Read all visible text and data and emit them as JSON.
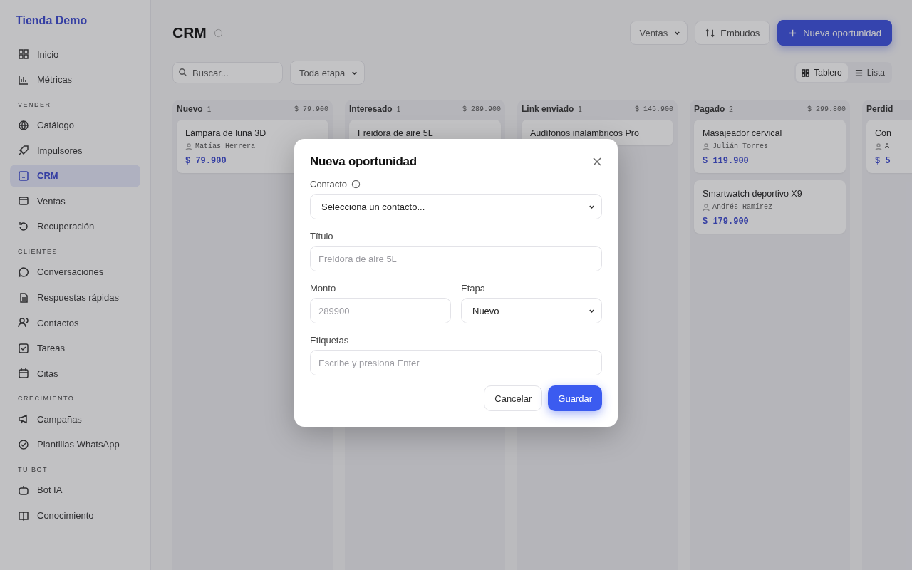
{
  "sidebar": {
    "brand": "Tienda Demo",
    "sections": [
      {
        "items": [
          {
            "label": "Inicio",
            "selected": false
          },
          {
            "label": "Métricas",
            "selected": false
          }
        ]
      },
      {
        "heading": "VENDER",
        "items": [
          {
            "label": "Catálogo",
            "selected": false
          },
          {
            "label": "Impulsores",
            "selected": false
          },
          {
            "label": "CRM",
            "selected": true
          },
          {
            "label": "Ventas",
            "selected": false
          },
          {
            "label": "Recuperación",
            "selected": false
          }
        ]
      },
      {
        "heading": "CLIENTES",
        "items": [
          {
            "label": "Conversaciones",
            "selected": false
          },
          {
            "label": "Respuestas rápidas",
            "selected": false
          },
          {
            "label": "Contactos",
            "selected": false
          },
          {
            "label": "Tareas",
            "selected": false
          },
          {
            "label": "Citas",
            "selected": false
          }
        ]
      },
      {
        "heading": "CRECIMIENTO",
        "items": [
          {
            "label": "Campañas",
            "selected": false
          },
          {
            "label": "Plantillas WhatsApp",
            "selected": false
          }
        ]
      },
      {
        "heading": "TU BOT",
        "items": [
          {
            "label": "Bot IA",
            "selected": false
          },
          {
            "label": "Conocimiento",
            "selected": false
          }
        ]
      }
    ]
  },
  "header": {
    "title": "CRM",
    "pipeline_select": "Ventas",
    "funnels_button": "Embudos",
    "new_button": "Nueva oportunidad"
  },
  "toolbar": {
    "search": {
      "placeholder": "Buscar..."
    },
    "stage_select": "Toda etapa",
    "views": [
      {
        "label": "Tablero",
        "selected": true
      },
      {
        "label": "Lista",
        "selected": false
      }
    ]
  },
  "board": {
    "columns": [
      {
        "name": "Nuevo",
        "count": "1",
        "total": "$ 79.900",
        "cards": [
          {
            "title": "Lámpara de luna 3D",
            "contact": "Matías Herrera",
            "amount": "$ 79.900"
          }
        ]
      },
      {
        "name": "Interesado",
        "count": "1",
        "total": "$ 289.900",
        "cards": [
          {
            "title": "Freidora de aire 5L"
          }
        ]
      },
      {
        "name": "Link enviado",
        "count": "1",
        "total": "$ 145.900",
        "cards": [
          {
            "title": "Audífonos inalámbricos Pro"
          }
        ]
      },
      {
        "name": "Pagado",
        "count": "2",
        "total": "$ 299.800",
        "cards": [
          {
            "title": "Masajeador cervical",
            "contact": "Julián Torres",
            "amount": "$ 119.900"
          },
          {
            "title": "Smartwatch deportivo X9",
            "contact": "Andrés Ramírez",
            "amount": "$ 179.900"
          }
        ]
      },
      {
        "name": "Perdid",
        "cards": [
          {
            "title": "Con",
            "contact": "A",
            "amount": "$ 5"
          }
        ]
      }
    ]
  },
  "modal": {
    "title": "Nueva oportunidad",
    "contact": {
      "label": "Contacto",
      "value": "Selecciona un contacto..."
    },
    "title_field": {
      "label": "Título",
      "placeholder": "Freidora de aire 5L"
    },
    "amount": {
      "label": "Monto",
      "placeholder": "289900"
    },
    "stage": {
      "label": "Etapa",
      "value": "Nuevo"
    },
    "tags": {
      "label": "Etiquetas",
      "placeholder": "Escribe y presiona Enter"
    },
    "buttons": {
      "cancel": "Cancelar",
      "save": "Guardar"
    }
  }
}
